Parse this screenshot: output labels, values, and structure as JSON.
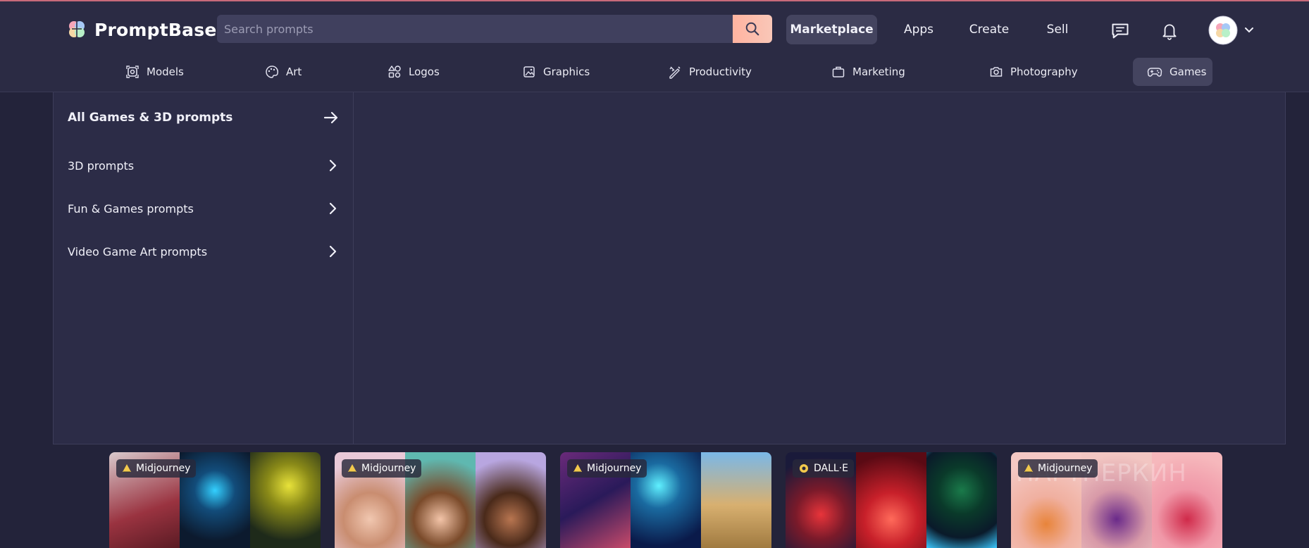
{
  "brand": {
    "name": "PromptBase"
  },
  "search": {
    "placeholder": "Search prompts"
  },
  "topnav": {
    "marketplace": "Marketplace",
    "apps": "Apps",
    "create": "Create",
    "sell": "Sell"
  },
  "categories": [
    {
      "label": "Models",
      "icon": "models-icon"
    },
    {
      "label": "Art",
      "icon": "palette-icon"
    },
    {
      "label": "Logos",
      "icon": "shapes-icon"
    },
    {
      "label": "Graphics",
      "icon": "image-icon"
    },
    {
      "label": "Productivity",
      "icon": "pen-ruler-icon"
    },
    {
      "label": "Marketing",
      "icon": "briefcase-icon"
    },
    {
      "label": "Photography",
      "icon": "camera-icon"
    },
    {
      "label": "Games",
      "icon": "gamepad-icon"
    }
  ],
  "dropdown": {
    "all": "All Games & 3D prompts",
    "items": [
      "3D prompts",
      "Fun & Games prompts",
      "Video Game Art prompts"
    ]
  },
  "cards": [
    {
      "model": "Midjourney"
    },
    {
      "model": "Midjourney"
    },
    {
      "model": "Midjourney"
    },
    {
      "model": "DALL·E"
    },
    {
      "model": "Midjourney"
    }
  ],
  "watermark": "ПАРТНЕРКИН",
  "colors": {
    "accent": "#ffb3a0",
    "header_bg": "#2b2b44",
    "active_bg": "#44445f"
  }
}
